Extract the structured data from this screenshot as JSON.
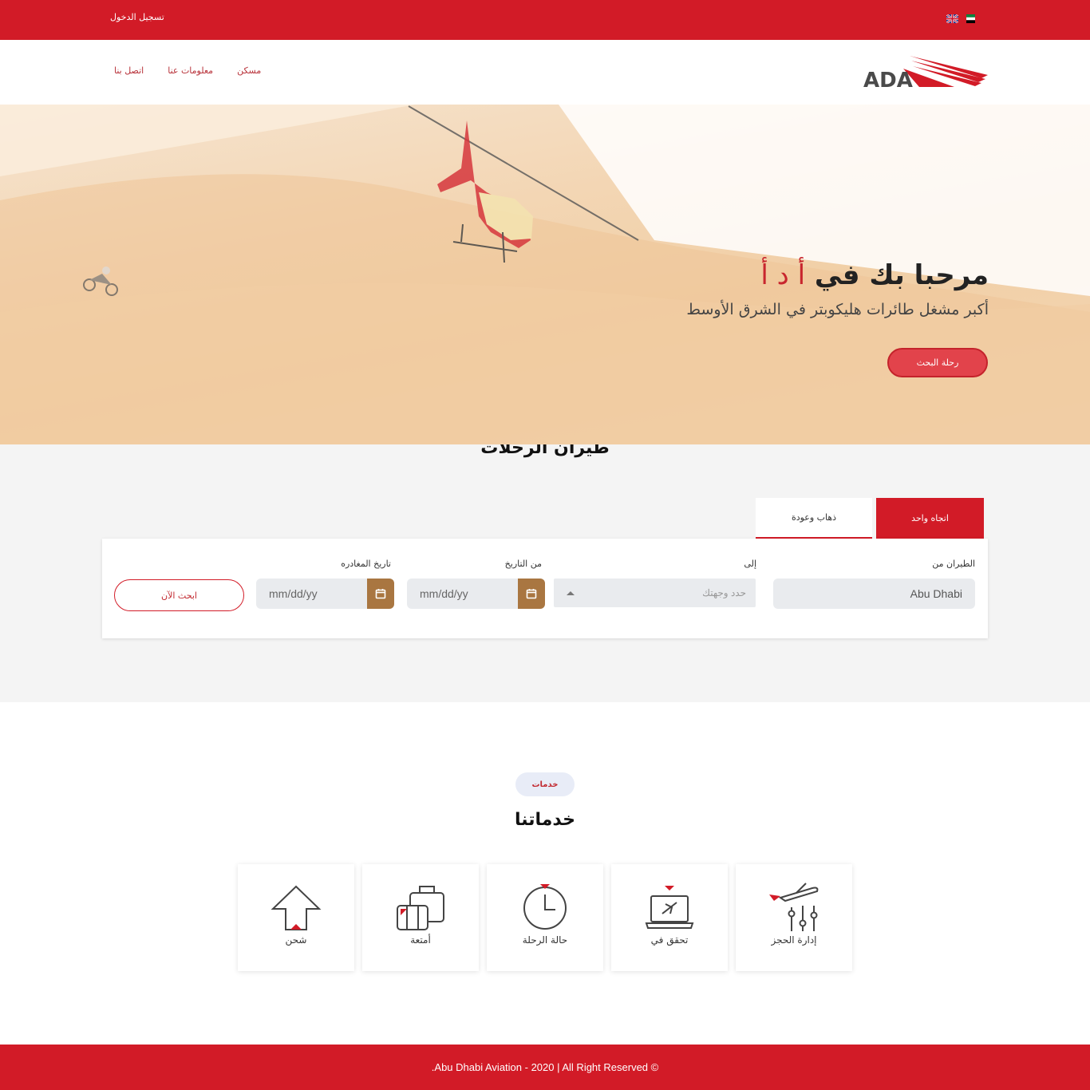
{
  "topbar": {
    "login_label": "تسجيل الدخول",
    "flags": [
      "uk-flag-icon",
      "uae-flag-icon"
    ]
  },
  "nav": {
    "items": [
      "اتصل بنا",
      "معلومات عنا",
      "مسكن"
    ]
  },
  "logo": {
    "text": "ADA"
  },
  "hero": {
    "title_main": "مرحبا بك في ",
    "title_accent": "أ د أ",
    "subtitle": "أكبر مشغل طائرات هليكوبتر في الشرق الأوسط",
    "button_label": "رحلة البحث"
  },
  "booking": {
    "title": "طيران الرحلات",
    "tabs": [
      {
        "label": "اتجاه واحد",
        "active": true
      },
      {
        "label": "ذهاب وعودة",
        "active": false
      }
    ],
    "from_label": "الطيران من",
    "from_value": "Abu Dhabi",
    "to_label": "إلى",
    "to_placeholder": "حدد وجهتك",
    "date_from_label": "من التاريخ",
    "date_from_placeholder": "mm/dd/yy",
    "date_depart_label": "تاريخ المغادره",
    "date_depart_placeholder": "mm/dd/yy",
    "search_label": "ابحث الآن"
  },
  "services": {
    "badge": "خدمات",
    "title": "خدماتنا",
    "cards": [
      {
        "label": "شحن",
        "icon": "cargo-arrow-icon"
      },
      {
        "label": "أمتعة",
        "icon": "luggage-icon"
      },
      {
        "label": "حالة الرحلة",
        "icon": "clock-icon"
      },
      {
        "label": "تحقق في",
        "icon": "laptop-plane-icon"
      },
      {
        "label": "إدارة الحجز",
        "icon": "plane-sliders-icon"
      }
    ]
  },
  "footer": {
    "copyright": ".Abu Dhabi Aviation - 2020 | All Right Reserved ©"
  },
  "colors": {
    "brand_red": "#d21b27",
    "calendar_brown": "#a97641",
    "booking_bg": "#f4f4f4"
  }
}
